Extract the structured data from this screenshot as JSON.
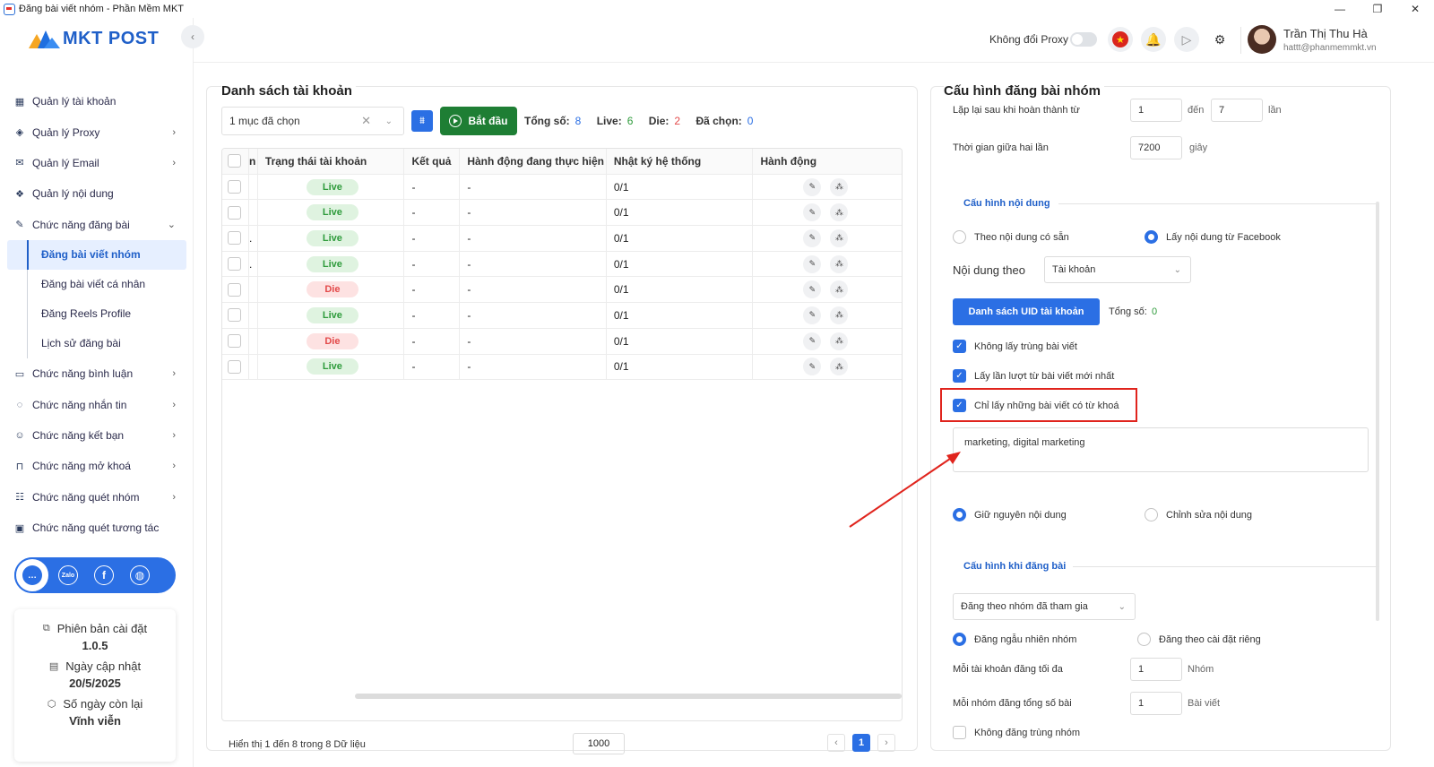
{
  "window": {
    "title": "Đăng bài viết nhóm - Phần Mềm MKT",
    "min": "—",
    "restore": "❐",
    "close": "✕"
  },
  "logo": {
    "text": "MKT POST"
  },
  "sidebar": {
    "collapse": "‹",
    "items": [
      {
        "label": "Quản lý tài khoản",
        "icon": "grid-icon",
        "glyph": "▦",
        "chev": ""
      },
      {
        "label": "Quản lý Proxy",
        "icon": "layers-icon",
        "glyph": "◈",
        "chev": "›"
      },
      {
        "label": "Quản lý Email",
        "icon": "mail-icon",
        "glyph": "✉",
        "chev": "›"
      },
      {
        "label": "Quản lý nội dung",
        "icon": "content-icon",
        "glyph": "❖",
        "chev": ""
      },
      {
        "label": "Chức năng đăng bài",
        "icon": "post-icon",
        "glyph": "✎",
        "chev": "⌄"
      }
    ],
    "sub_items": [
      {
        "label": "Đăng bài viết nhóm"
      },
      {
        "label": "Đăng bài viết cá nhân"
      },
      {
        "label": "Đăng Reels Profile"
      },
      {
        "label": "Lịch sử đăng bài"
      }
    ],
    "items2": [
      {
        "label": "Chức năng bình luận",
        "icon": "comment-icon",
        "glyph": "▭",
        "chev": "›"
      },
      {
        "label": "Chức năng nhắn tin",
        "icon": "chat-icon",
        "glyph": "◌",
        "chev": "›"
      },
      {
        "label": "Chức năng kết bạn",
        "icon": "add-friend-icon",
        "glyph": "☺",
        "chev": "›"
      },
      {
        "label": "Chức năng mở khoá",
        "icon": "unlock-icon",
        "glyph": "⊓",
        "chev": "›"
      },
      {
        "label": "Chức năng quét nhóm",
        "icon": "group-icon",
        "glyph": "☷",
        "chev": "›"
      },
      {
        "label": "Chức năng quét tương tác",
        "icon": "scan-icon",
        "glyph": "▣",
        "chev": ""
      }
    ],
    "social": [
      {
        "icon": "support-icon",
        "glyph": "…",
        "color": "#2b6fe4"
      },
      {
        "icon": "zalo-icon",
        "glyph": "Zalo",
        "color": "#ffffff"
      },
      {
        "icon": "facebook-icon",
        "glyph": "f",
        "color": "#ffffff"
      },
      {
        "icon": "globe-icon",
        "glyph": "◍",
        "color": "#ffffff"
      }
    ],
    "info": {
      "version_label": "Phiên bản cài đặt",
      "version_value": "1.0.5",
      "update_label": "Ngày cập nhật",
      "update_value": "20/5/2025",
      "days_label": "Số ngày còn lại",
      "days_value": "Vĩnh viễn",
      "version_glyph": "⧉",
      "update_glyph": "▤",
      "days_glyph": "⬡"
    }
  },
  "header": {
    "proxy_label": "Không đổi Proxy",
    "flag_glyph": "★",
    "bell_glyph": "🔔",
    "play_glyph": "▷",
    "gear_glyph": "⚙",
    "user_name": "Trần Thị Thu Hà",
    "user_email": "hattt@phanmemmkt.vn"
  },
  "accounts": {
    "title": "Danh sách tài khoản",
    "select_value": "1 mục đã chọn",
    "clear_glyph": "✕",
    "dropdown_glyph": "⌄",
    "filter_glyph": "⩩",
    "start_label": "Bắt đầu",
    "total_label": "Tổng số:",
    "total_value": "8",
    "live_label": "Live:",
    "live_value": "6",
    "die_label": "Die:",
    "die_value": "2",
    "selected_label": "Đã chọn:",
    "selected_value": "0",
    "columns": [
      "n",
      "Trạng thái tài khoản",
      "Kết quả",
      "Hành động đang thực hiện",
      "Nhật ký hệ thống",
      "Hành động"
    ],
    "rows": [
      {
        "c1": "",
        "status": "Live",
        "result": "-",
        "action": "-",
        "log": "0/1"
      },
      {
        "c1": "",
        "status": "Live",
        "result": "-",
        "action": "-",
        "log": "0/1"
      },
      {
        "c1": ".",
        "status": "Live",
        "result": "-",
        "action": "-",
        "log": "0/1"
      },
      {
        "c1": ".",
        "status": "Live",
        "result": "-",
        "action": "-",
        "log": "0/1"
      },
      {
        "c1": "",
        "status": "Die",
        "result": "-",
        "action": "-",
        "log": "0/1"
      },
      {
        "c1": "",
        "status": "Live",
        "result": "-",
        "action": "-",
        "log": "0/1"
      },
      {
        "c1": "",
        "status": "Die",
        "result": "-",
        "action": "-",
        "log": "0/1"
      },
      {
        "c1": "",
        "status": "Live",
        "result": "-",
        "action": "-",
        "log": "0/1"
      }
    ],
    "edit_glyph": "✎",
    "group_glyph": "⁂",
    "footer": "Hiển thị 1 đến 8 trong 8 Dữ liệu",
    "page_size": "1000",
    "prev": "‹",
    "page": "1",
    "next": "›"
  },
  "config": {
    "title": "Cấu hình đăng bài nhóm",
    "repeat_label": "Lặp lại sau khi hoàn thành từ",
    "repeat_from": "1",
    "repeat_to_label": "đến",
    "repeat_to": "7",
    "repeat_unit": "lần",
    "interval_label": "Thời gian giữa hai lần",
    "interval_value": "7200",
    "interval_unit": "giây",
    "content_section": "Cấu hình nội dung",
    "radio_existing": "Theo nội dung có sẵn",
    "radio_facebook": "Lấy nội dung từ Facebook",
    "content_by_label": "Nội dung theo",
    "content_by_value": "Tài khoản",
    "uid_button": "Danh sách UID tài khoản",
    "uid_total_label": "Tổng số:",
    "uid_total_value": "0",
    "chk_no_duplicate": "Không lấy trùng bài viết",
    "chk_latest": "Lấy lần lượt từ bài viết mới nhất",
    "chk_keyword": "Chỉ lấy những bài viết có từ khoá",
    "check_glyph": "✓",
    "keywords": "marketing, digital marketing",
    "radio_keep": "Giữ nguyên nội dung",
    "radio_edit": "Chỉnh sửa nội dung",
    "post_section": "Cấu hình khi đăng bài",
    "post_mode": "Đăng theo nhóm đã tham gia",
    "radio_random": "Đăng ngẫu nhiên nhóm",
    "radio_custom": "Đăng theo cài đặt riêng",
    "max_label": "Mỗi tài khoản đăng tối đa",
    "max_value": "1",
    "max_unit": "Nhóm",
    "per_group_label": "Mỗi nhóm đăng tổng số bài",
    "per_group_value": "1",
    "per_group_unit": "Bài viết",
    "chk_no_dup_group": "Không đăng trùng nhóm"
  },
  "colors": {
    "accent": "#2b6fe4",
    "start": "#1e7e34",
    "live": "#2e9b3b",
    "die": "#e34a4a",
    "highlight": "#e0241d"
  }
}
